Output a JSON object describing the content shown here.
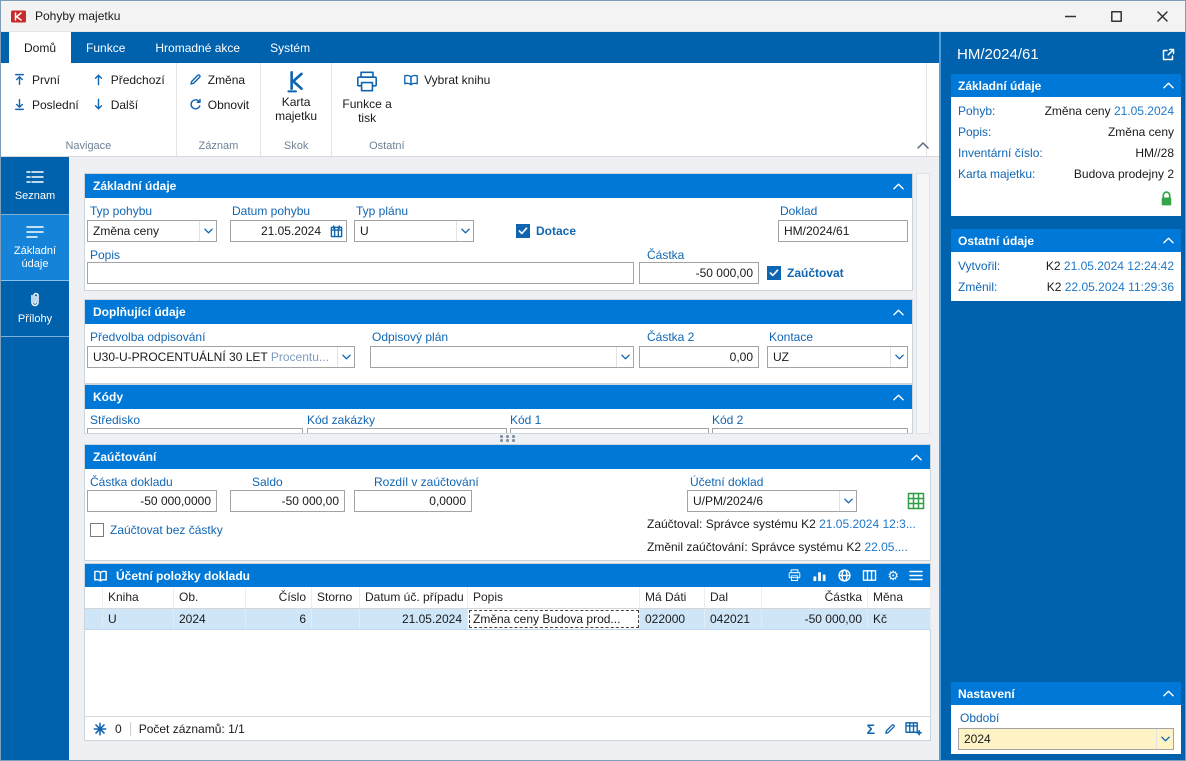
{
  "window": {
    "title": "Pohyby majetku"
  },
  "icons": {
    "sum": "Σ",
    "gear": "⚙"
  },
  "tabs": [
    {
      "label": "Domů"
    },
    {
      "label": "Funkce"
    },
    {
      "label": "Hromadné akce"
    },
    {
      "label": "Systém"
    }
  ],
  "ribbon": {
    "first": "První",
    "last": "Poslední",
    "prev": "Předchozí",
    "next": "Další",
    "change": "Změna",
    "refresh": "Obnovit",
    "asset_card": "Karta majetku",
    "functions_print": "Funkce a tisk",
    "select_book": "Vybrat knihu",
    "group_navigace": "Navigace",
    "group_zaznam": "Záznam",
    "group_skok": "Skok",
    "group_ostatni": "Ostatní"
  },
  "sidebar": {
    "seznam": "Seznam",
    "zakladni": "Základní údaje",
    "prilohy": "Přílohy"
  },
  "basic": {
    "title": "Základní údaje",
    "typ_pohybu_label": "Typ pohybu",
    "typ_pohybu_value": "Změna ceny",
    "datum_label": "Datum pohybu",
    "datum_value": "21.05.2024",
    "typ_planu_label": "Typ plánu",
    "typ_planu_value": "U",
    "dotace_label": "Dotace",
    "doklad_label": "Doklad",
    "doklad_value": "HM/2024/61",
    "popis_label": "Popis",
    "popis_value": "",
    "castka_label": "Částka",
    "castka_value": "-50 000,00",
    "zauctovat_label": "Zaúčtovat"
  },
  "doplnujici": {
    "title": "Doplňující údaje",
    "predvolba_label": "Předvolba odpisování",
    "predvolba_value": "U30-U-PROCENTUÁLNÍ 30 LET",
    "predvolba_suffix": "Procentu...",
    "odpisovy_label": "Odpisový plán",
    "castka2_label": "Částka 2",
    "castka2_value": "0,00",
    "kontace_label": "Kontace",
    "kontace_value": "UZ"
  },
  "kody": {
    "title": "Kódy",
    "stredisko_label": "Středisko",
    "zakazka_label": "Kód zakázky",
    "kod1_label": "Kód 1",
    "kod2_label": "Kód 2"
  },
  "zauct": {
    "title": "Zaúčtování",
    "castka_dokladu_label": "Částka dokladu",
    "castka_dokladu_value": "-50 000,0000",
    "saldo_label": "Saldo",
    "saldo_value": "-50 000,00",
    "rozdil_label": "Rozdíl v zaúčtování",
    "rozdil_value": "0,0000",
    "ucetni_doklad_label": "Účetní doklad",
    "ucetni_doklad_value": "U/PM/2024/6",
    "bez_castky_label": "Zaúčtovat bez částky",
    "zauctoval_label": "Zaúčtoval:",
    "zauctoval_name": "Správce systému K2",
    "zauctoval_date": "21.05.2024 12:3...",
    "zmenil_label": "Změnil zaúčtování:",
    "zmenil_name": "Správce systému K2",
    "zmenil_date": "22.05...."
  },
  "items_table": {
    "title": "Účetní položky dokladu",
    "columns": [
      "Kniha",
      "Ob.",
      "Číslo",
      "Storno",
      "Datum úč. případu",
      "Popis",
      "Má Dáti",
      "Dal",
      "Částka",
      "Měna"
    ],
    "row": {
      "kniha": "U",
      "ob": "2024",
      "cislo": "6",
      "storno": "",
      "datum": "21.05.2024",
      "popis": "Změna ceny Budova prod...",
      "ma_dati": "022000",
      "dal": "042021",
      "castka": "-50 000,00",
      "mena": "Kč"
    },
    "footer": {
      "star_count": "0",
      "records": "Počet záznamů: 1/1"
    }
  },
  "right": {
    "record_id": "HM/2024/61",
    "basic": {
      "title": "Základní údaje",
      "pohyb_label": "Pohyb:",
      "pohyb_value": "Změna ceny",
      "pohyb_date": "21.05.2024",
      "popis_label": "Popis:",
      "popis_value": "Změna ceny",
      "inv_label": "Inventární číslo:",
      "inv_value": "HM//28",
      "karta_label": "Karta majetku:",
      "karta_value": "Budova prodejny 2"
    },
    "other": {
      "title": "Ostatní údaje",
      "vytvoril_label": "Vytvořil:",
      "vytvoril_name": "K2",
      "vytvoril_date": "21.05.2024 12:24:42",
      "zmenil_label": "Změnil:",
      "zmenil_name": "K2",
      "zmenil_date": "22.05.2024 11:29:36"
    },
    "settings": {
      "title": "Nastavení",
      "obdobi_label": "Období",
      "obdobi_value": "2024"
    }
  }
}
